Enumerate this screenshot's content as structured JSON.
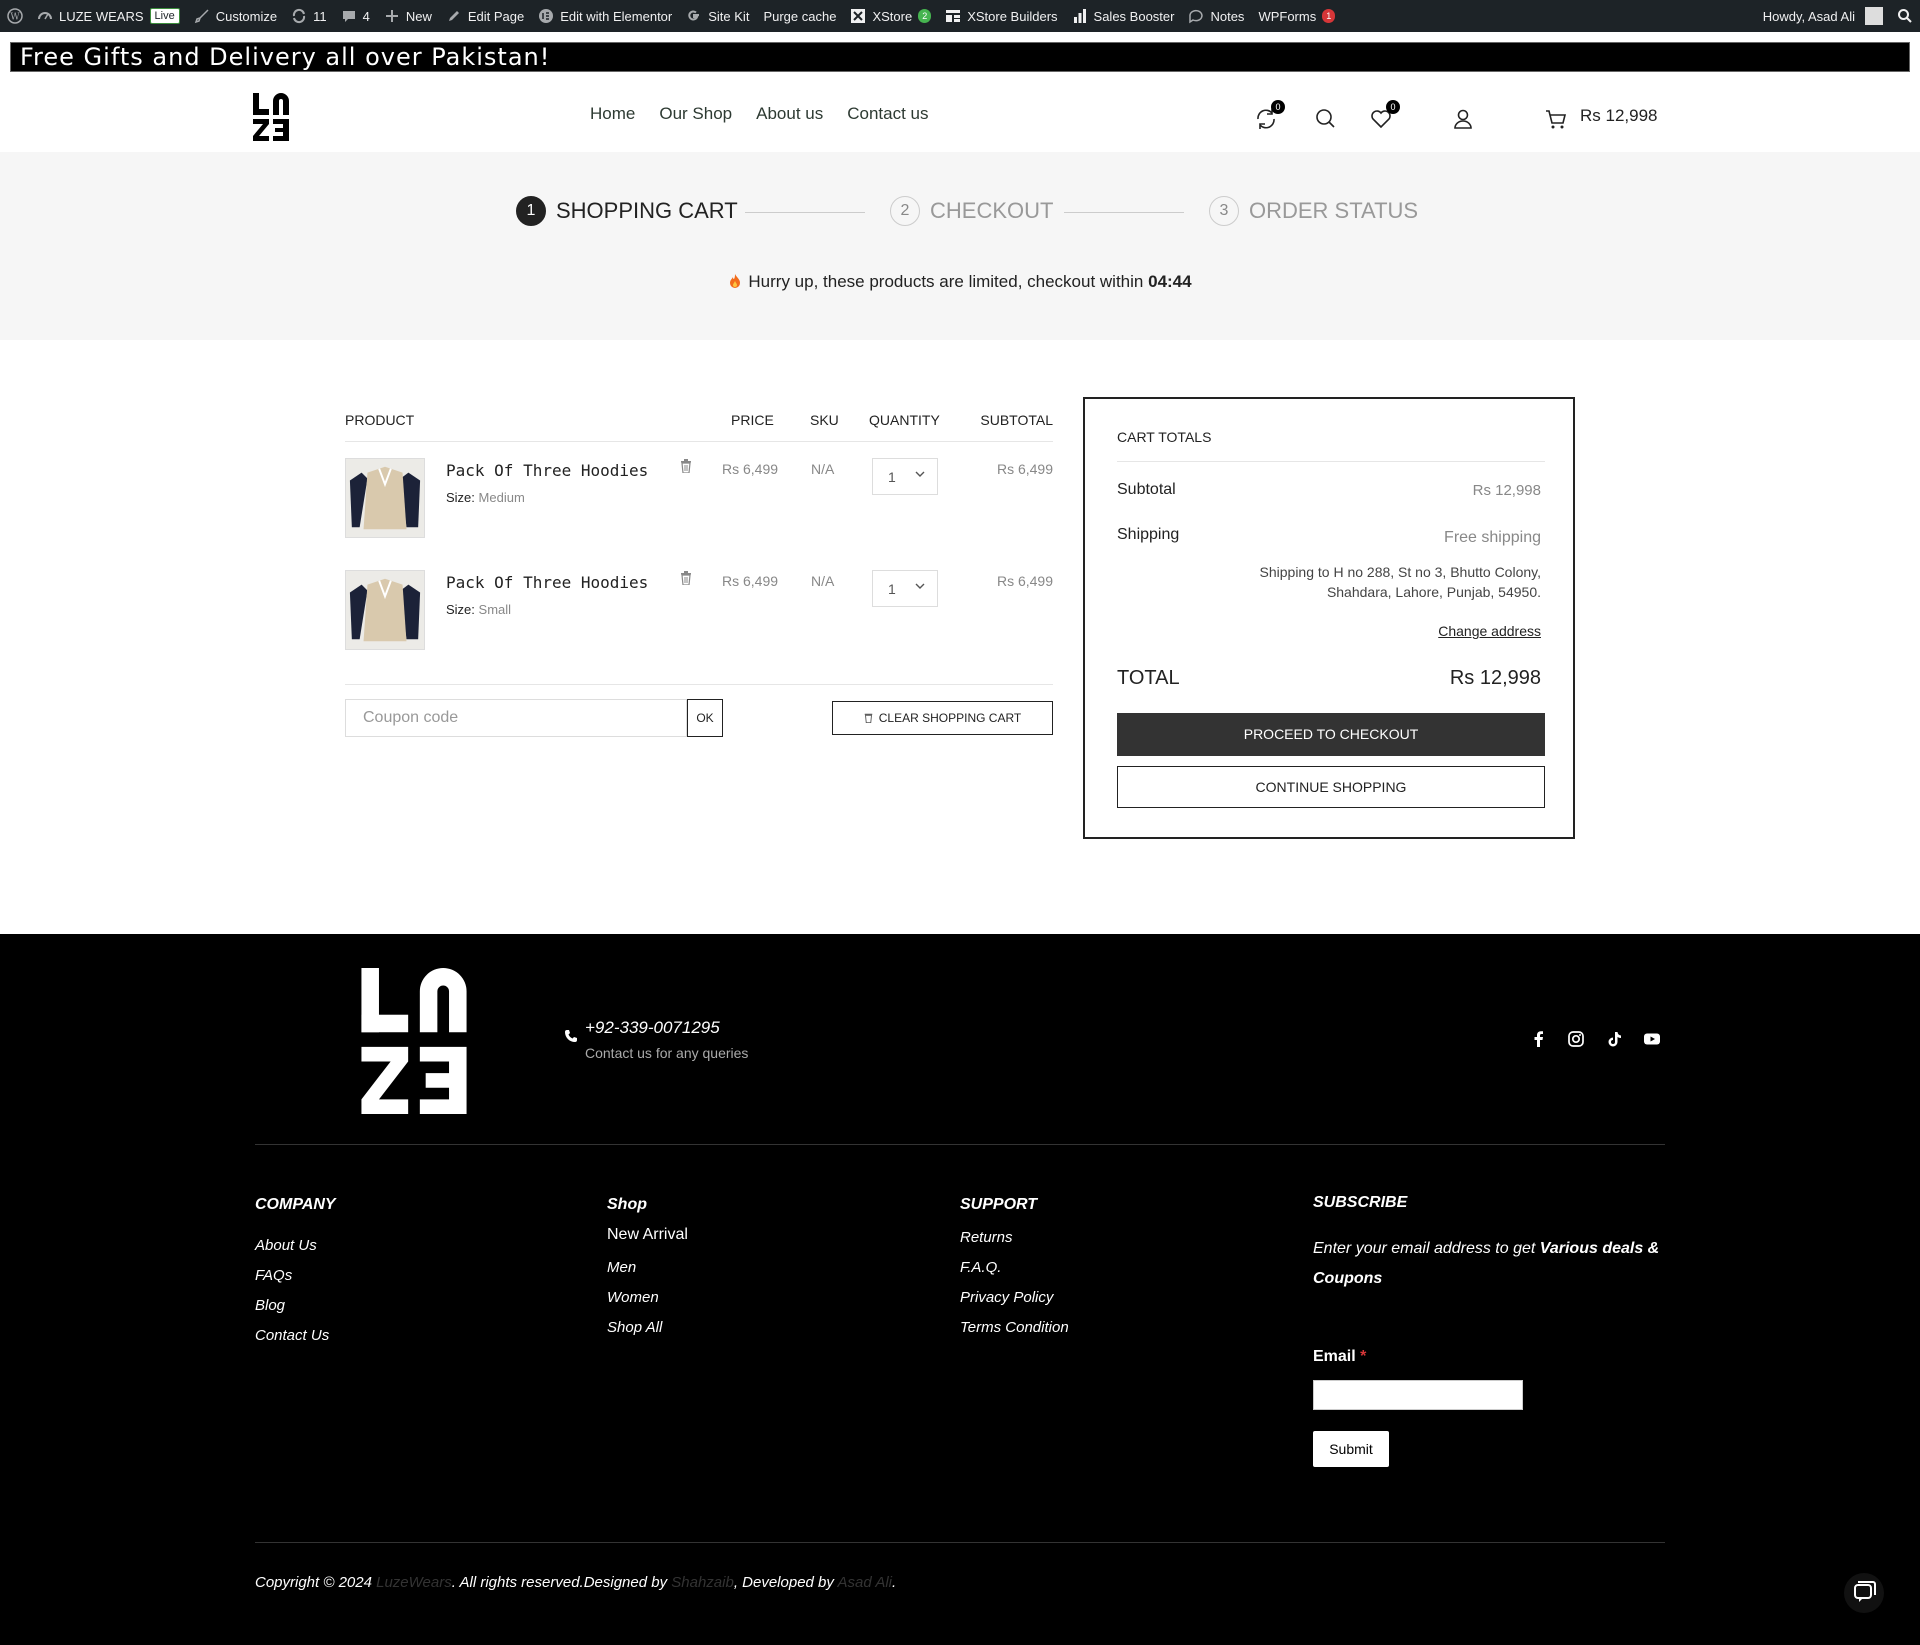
{
  "adminbar": {
    "site": "LUZE WEARS",
    "live": "Live",
    "customize": "Customize",
    "updates": "11",
    "comments": "4",
    "new": "New",
    "edit_page": "Edit Page",
    "elementor": "Edit with Elementor",
    "sitekit": "Site Kit",
    "purge": "Purge cache",
    "xstore": "XStore",
    "xstore_badge": "2",
    "xstore_builders": "XStore Builders",
    "sales_booster": "Sales Booster",
    "notes": "Notes",
    "wpforms": "WPForms",
    "wpforms_badge": "1",
    "howdy": "Howdy, Asad Ali"
  },
  "promo": "Free Gifts and Delivery all over Pakistan!",
  "header": {
    "nav": [
      "Home",
      "Our Shop",
      "About us",
      "Contact us"
    ],
    "compare_count": "0",
    "wishlist_count": "0",
    "cart_amount": "Rs 12,998"
  },
  "steps": [
    {
      "num": "1",
      "label": "SHOPPING CART"
    },
    {
      "num": "2",
      "label": "CHECKOUT"
    },
    {
      "num": "3",
      "label": "ORDER STATUS"
    }
  ],
  "hurry": {
    "text": "Hurry up, these products are limited, checkout within",
    "time": "04:44"
  },
  "cart": {
    "headers": {
      "product": "PRODUCT",
      "price": "PRICE",
      "sku": "SKU",
      "quantity": "QUANTITY",
      "subtotal": "SUBTOTAL"
    },
    "items": [
      {
        "name": "Pack Of Three Hoodies",
        "size_label": "Size:",
        "size": "Medium",
        "price": "Rs 6,499",
        "sku": "N/A",
        "qty": "1",
        "subtotal": "Rs 6,499"
      },
      {
        "name": "Pack Of Three Hoodies",
        "size_label": "Size:",
        "size": "Small",
        "price": "Rs 6,499",
        "sku": "N/A",
        "qty": "1",
        "subtotal": "Rs 6,499"
      }
    ],
    "coupon_placeholder": "Coupon code",
    "ok": "OK",
    "clear": "CLEAR SHOPPING CART"
  },
  "totals": {
    "title": "CART TOTALS",
    "subtotal_label": "Subtotal",
    "subtotal_value": "Rs 12,998",
    "shipping_label": "Shipping",
    "shipping_value": "Free shipping",
    "shipping_address": "Shipping to H no 288, St no 3, Bhutto Colony, Shahdara, Lahore, Punjab, 54950.",
    "change_address": "Change address",
    "total_label": "TOTAL",
    "total_value": "Rs 12,998",
    "checkout": "PROCEED TO CHECKOUT",
    "continue": "CONTINUE SHOPPING"
  },
  "footer": {
    "phone": "+92-339-0071295",
    "phone_sub": "Contact us for any queries",
    "company": {
      "title": "COMPANY",
      "links": [
        "About Us",
        "FAQs",
        "Blog",
        "Contact Us"
      ]
    },
    "shop": {
      "title": "Shop",
      "links": [
        "New Arrival",
        "Men",
        "Women",
        "Shop All"
      ]
    },
    "support": {
      "title": "SUPPORT",
      "links": [
        "Returns",
        "F.A.Q.",
        "Privacy Policy",
        "Terms Condition"
      ]
    },
    "subscribe": {
      "title": "SUBSCRIBE",
      "text_a": "Enter your email address to get ",
      "text_b": "Various deals & Coupons",
      "email_label": "Email",
      "required": "*",
      "submit": "Submit"
    },
    "copyright": {
      "a": "Copyright © 2024 ",
      "b": "LuzeWears",
      "c": ". All rights reserved.Designed by ",
      "d": "Shahzaib",
      "e": ", Developed by ",
      "f": "Asad Ali",
      "g": "."
    }
  }
}
